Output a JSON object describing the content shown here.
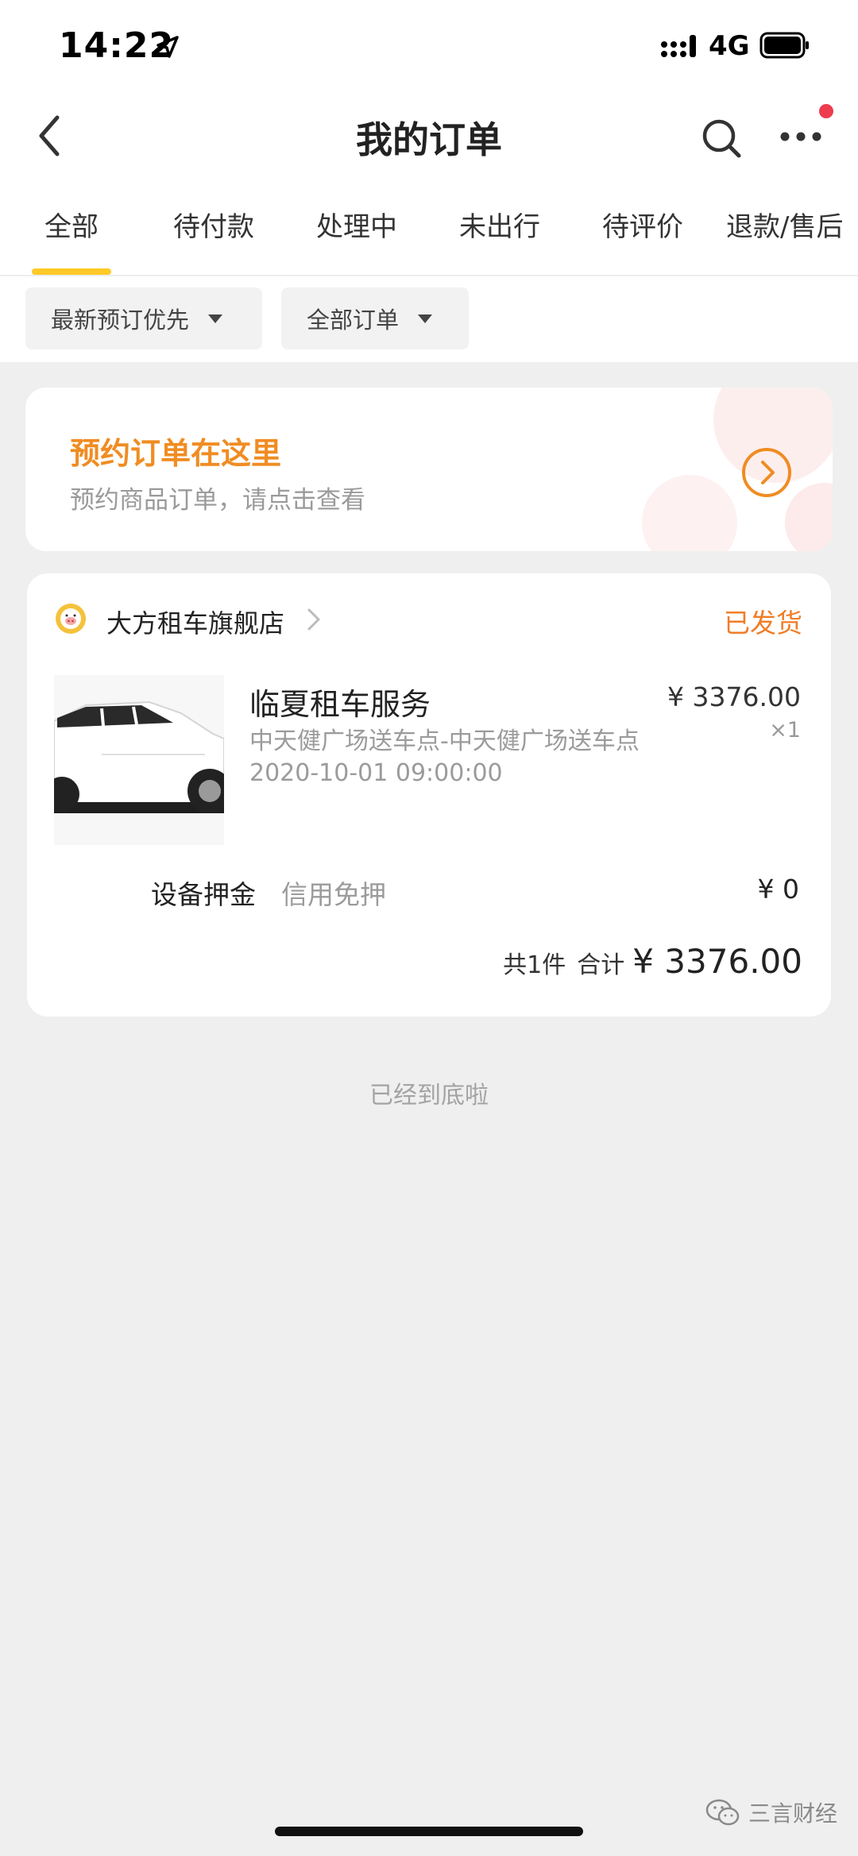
{
  "status_bar": {
    "time": "14:22",
    "network": "4G",
    "icons": [
      "location-arrow-icon",
      "signal-icon",
      "battery-icon"
    ]
  },
  "nav": {
    "title": "我的订单",
    "icons": [
      "back-icon",
      "search-icon",
      "more-icon"
    ]
  },
  "tabs": [
    {
      "label": "全部",
      "active": true
    },
    {
      "label": "待付款"
    },
    {
      "label": "处理中"
    },
    {
      "label": "未出行"
    },
    {
      "label": "待评价"
    },
    {
      "label": "退款/售后"
    }
  ],
  "filters": {
    "sort": "最新预订优先",
    "type": "全部订单"
  },
  "booking_banner": {
    "title": "预约订单在这里",
    "subtitle": "预约商品订单，请点击查看"
  },
  "order": {
    "store_name": "大方租车旗舰店",
    "status": "已发货",
    "product_title": "临夏租车服务",
    "product_desc": "中天健广场送车点-中天健广场送车点 2020-10-01 09:00:00",
    "price": "¥ 3376.00",
    "quantity": "×1",
    "deposit_label": "设备押金",
    "deposit_note": "信用免押",
    "deposit_amount": "¥ 0",
    "total_count": "共1件",
    "total_label": "合计",
    "total_amount": "¥ 3376.00"
  },
  "end_text": "已经到底啦",
  "watermark": "三言财经",
  "colors": {
    "accent_orange": "#f07d27",
    "tab_indicator": "#ffc928",
    "notification_dot": "#ee3b4e",
    "background": "#efefef"
  }
}
